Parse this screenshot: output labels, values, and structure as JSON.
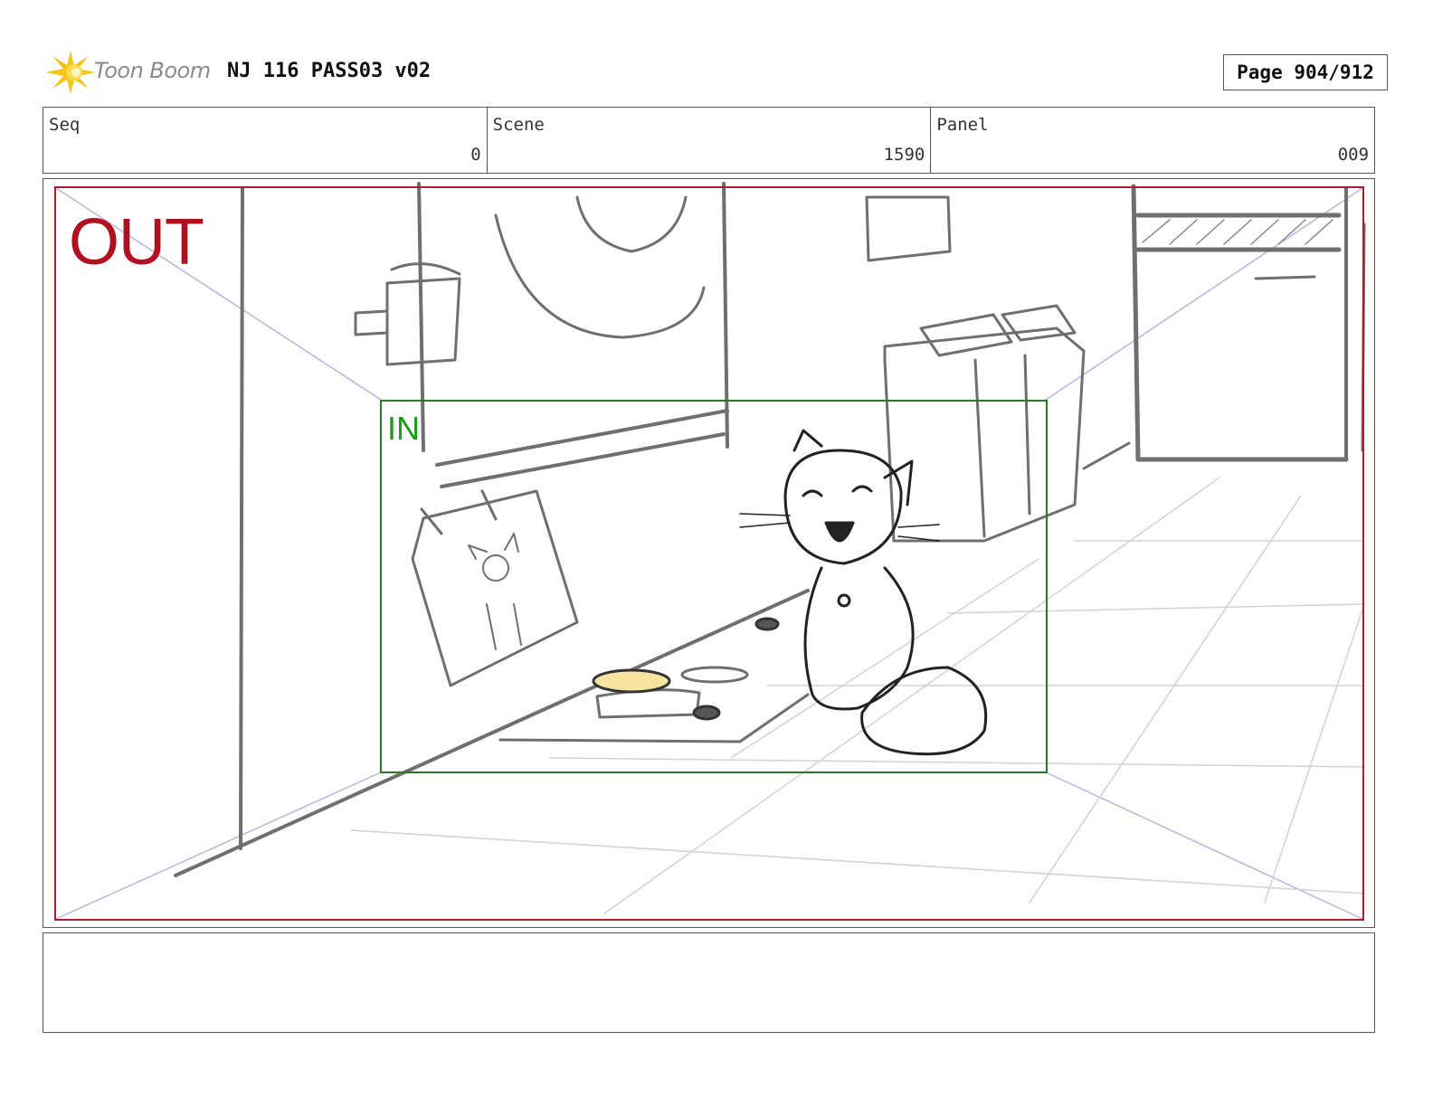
{
  "header": {
    "logo_text": "Toon Boom",
    "project_title": "NJ 116 PASS03 v02",
    "page_label": "Page 904/912"
  },
  "info": {
    "seq_label": "Seq",
    "seq_value": "0",
    "scene_label": "Scene",
    "scene_value": "1590",
    "panel_label": "Panel",
    "panel_value": "009"
  },
  "panel": {
    "out_label": "OUT",
    "in_label": "IN"
  },
  "colors": {
    "out_frame": "#b01c2e",
    "in_frame": "#2a7a2a",
    "sketch": "#6f6f6f",
    "perspective": "#b7b4e6",
    "food": "#f7e3a0"
  }
}
